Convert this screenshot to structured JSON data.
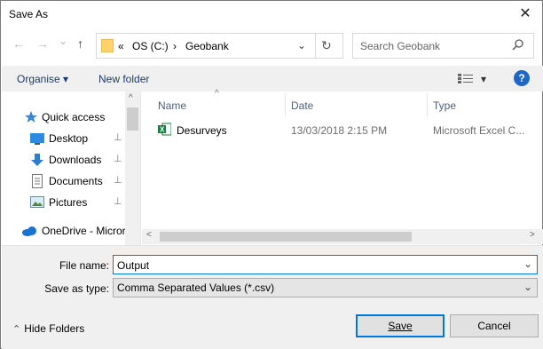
{
  "window": {
    "title": "Save As",
    "close_glyph": "✕"
  },
  "nav": {
    "back_glyph": "←",
    "forward_glyph": "→",
    "recent_glyph": "⌄",
    "up_glyph": "↑",
    "breadcrumb_prefix": "«",
    "breadcrumb": [
      "OS (C:)",
      "Geobank"
    ],
    "breadcrumb_separator": "›",
    "dropdown_glyph": "⌄",
    "refresh_glyph": "↻",
    "search_placeholder": "Search Geobank"
  },
  "toolbar": {
    "organise_label": "Organise ▾",
    "new_folder_label": "New folder",
    "view_glyph": "▾",
    "help_label": "?"
  },
  "sidebar": {
    "items": [
      {
        "label": "Quick access",
        "icon": "star-icon",
        "pinned": false
      },
      {
        "label": "Desktop",
        "icon": "desktop-icon",
        "pinned": true
      },
      {
        "label": "Downloads",
        "icon": "download-icon",
        "pinned": true
      },
      {
        "label": "Documents",
        "icon": "document-icon",
        "pinned": true
      },
      {
        "label": "Pictures",
        "icon": "picture-icon",
        "pinned": true
      },
      {
        "label": "OneDrive - Micror",
        "icon": "cloud-icon",
        "pinned": false
      }
    ],
    "pin_glyph": "📌"
  },
  "file_list": {
    "columns": [
      "Name",
      "Date",
      "Type"
    ],
    "sort_glyph": "^",
    "rows": [
      {
        "name": "Desurveys",
        "date": "13/03/2018 2:15 PM",
        "type": "Microsoft Excel C...",
        "icon": "excel-icon"
      }
    ]
  },
  "scroll": {
    "left_glyph": "<",
    "right_glyph": ">",
    "up_glyph": "^"
  },
  "form": {
    "file_name_label": "File name:",
    "file_name_value": "Output",
    "save_as_type_label": "Save as type:",
    "save_as_type_value": "Comma Separated Values (*.csv)",
    "chevron": "⌄"
  },
  "footer": {
    "hide_folders_label": "Hide Folders",
    "hide_glyph": "⌃",
    "save_label": "Save",
    "cancel_label": "Cancel"
  },
  "colors": {
    "accent": "#0078d7",
    "toolbar_text": "#1f3a6e",
    "help_bg": "#1e67c6",
    "excel_green": "#1d7a3e"
  }
}
